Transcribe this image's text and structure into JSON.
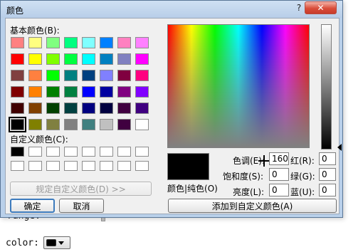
{
  "dialog": {
    "title": "颜色",
    "help_icon": "question-mark-icon",
    "close_icon": "close-icon",
    "basic_colors_label": "基本颜色(B):",
    "custom_colors_label": "自定义颜色(C):",
    "define_custom_button": "规定自定义颜色(D) >>",
    "ok_button": "确定",
    "cancel_button": "取消",
    "preview_label": "颜色|纯色(O)",
    "fields": {
      "hue_label": "色调(E):",
      "hue_value": "160",
      "sat_label": "饱和度(S):",
      "sat_value": "0",
      "lum_label": "亮度(L):",
      "lum_value": "0",
      "red_label": "红(R):",
      "red_value": "0",
      "green_label": "绿(G):",
      "green_value": "0",
      "blue_label": "蓝(U):",
      "blue_value": "0"
    },
    "add_custom_button": "添加到自定义颜色(A)",
    "selected_color": "#000000",
    "basic_colors": [
      "#ff8080",
      "#ffff80",
      "#80ff80",
      "#00ff80",
      "#80ffff",
      "#0080ff",
      "#ff80c0",
      "#ff80ff",
      "#ff0000",
      "#ffff00",
      "#80ff00",
      "#00ff40",
      "#00ffff",
      "#0080c0",
      "#8080c0",
      "#ff00ff",
      "#804040",
      "#ff8040",
      "#00ff00",
      "#008080",
      "#004080",
      "#8080ff",
      "#800040",
      "#ff0080",
      "#800000",
      "#ff8000",
      "#008000",
      "#008040",
      "#0000ff",
      "#0000a0",
      "#800080",
      "#8000ff",
      "#400000",
      "#804000",
      "#004000",
      "#004040",
      "#000080",
      "#000040",
      "#400040",
      "#400080",
      "#000000",
      "#808000",
      "#808040",
      "#808080",
      "#408080",
      "#c0c0c0",
      "#400040",
      "#ffffff"
    ],
    "custom_colors": [
      "#000000",
      "#ffffff",
      "#ffffff",
      "#ffffff",
      "#ffffff",
      "#ffffff",
      "#ffffff",
      "#ffffff",
      "#ffffff",
      "#ffffff",
      "#ffffff",
      "#ffffff",
      "#ffffff",
      "#ffffff",
      "#ffffff",
      "#ffffff"
    ]
  },
  "page": {
    "range_label": "range:",
    "color_label": "color:",
    "color_value": "#000000"
  }
}
